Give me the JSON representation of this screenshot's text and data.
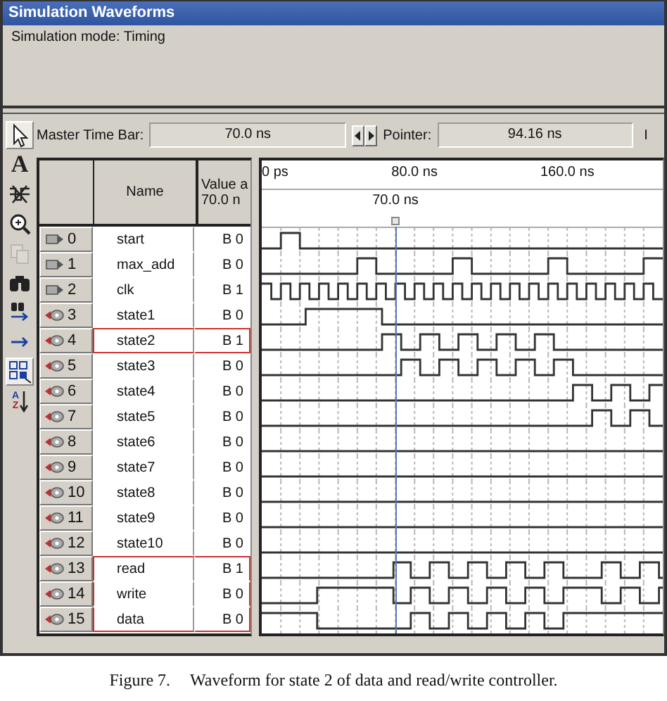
{
  "window": {
    "title": "Simulation Waveforms"
  },
  "mode": "Simulation mode: Timing",
  "toolbar": {
    "master_label": "Master Time Bar:",
    "master_value": "70.0 ns",
    "pointer_label": "Pointer:",
    "pointer_value": "94.16 ns",
    "cut_label": "I"
  },
  "tools": [
    {
      "kind": "select",
      "selected": true,
      "disabled": false
    },
    {
      "kind": "text",
      "glyph": "A",
      "selected": false,
      "disabled": false
    },
    {
      "kind": "edit",
      "selected": false,
      "disabled": false
    },
    {
      "kind": "zoom",
      "selected": false,
      "disabled": false
    },
    {
      "kind": "copy",
      "selected": false,
      "disabled": true
    },
    {
      "kind": "find",
      "selected": false,
      "disabled": false
    },
    {
      "kind": "find-next",
      "selected": false,
      "disabled": false
    },
    {
      "kind": "arrow",
      "selected": false,
      "disabled": false
    },
    {
      "kind": "snap",
      "selected": true,
      "disabled": false
    },
    {
      "kind": "sort",
      "letters": [
        "A",
        "Z"
      ],
      "selected": false,
      "disabled": false
    }
  ],
  "table": {
    "name_header": "Name",
    "value_header": "Value a",
    "value_subheader": "70.0 n"
  },
  "timeline": {
    "ticks": [
      "0 ps",
      "80.0 ns",
      "160.0 ns"
    ],
    "cursor": "70.0 ns"
  },
  "signals": [
    {
      "index": "0",
      "kind": "input",
      "name": "start",
      "value": "B 0",
      "highlighted": false
    },
    {
      "index": "1",
      "kind": "input",
      "name": "max_add",
      "value": "B 0",
      "highlighted": false
    },
    {
      "index": "2",
      "kind": "input",
      "name": "clk",
      "value": "B 1",
      "highlighted": false
    },
    {
      "index": "3",
      "kind": "output",
      "name": "state1",
      "value": "B 0",
      "highlighted": false
    },
    {
      "index": "4",
      "kind": "output",
      "name": "state2",
      "value": "B 1",
      "highlighted": true
    },
    {
      "index": "5",
      "kind": "output",
      "name": "state3",
      "value": "B 0",
      "highlighted": false
    },
    {
      "index": "6",
      "kind": "output",
      "name": "state4",
      "value": "B 0",
      "highlighted": false
    },
    {
      "index": "7",
      "kind": "output",
      "name": "state5",
      "value": "B 0",
      "highlighted": false
    },
    {
      "index": "8",
      "kind": "output",
      "name": "state6",
      "value": "B 0",
      "highlighted": false
    },
    {
      "index": "9",
      "kind": "output",
      "name": "state7",
      "value": "B 0",
      "highlighted": false
    },
    {
      "index": "10",
      "kind": "output",
      "name": "state8",
      "value": "B 0",
      "highlighted": false
    },
    {
      "index": "11",
      "kind": "output",
      "name": "state9",
      "value": "B 0",
      "highlighted": false
    },
    {
      "index": "12",
      "kind": "output",
      "name": "state10",
      "value": "B 0",
      "highlighted": false
    },
    {
      "index": "13",
      "kind": "output",
      "name": "read",
      "value": "B 1",
      "highlighted": true
    },
    {
      "index": "14",
      "kind": "output",
      "name": "write",
      "value": "B 0",
      "highlighted": true
    },
    {
      "index": "15",
      "kind": "output",
      "name": "data",
      "value": "B 0",
      "highlighted": true
    }
  ],
  "caption": {
    "label": "Figure 7.",
    "text": "Waveform for state 2 of data and read/write controller."
  }
}
